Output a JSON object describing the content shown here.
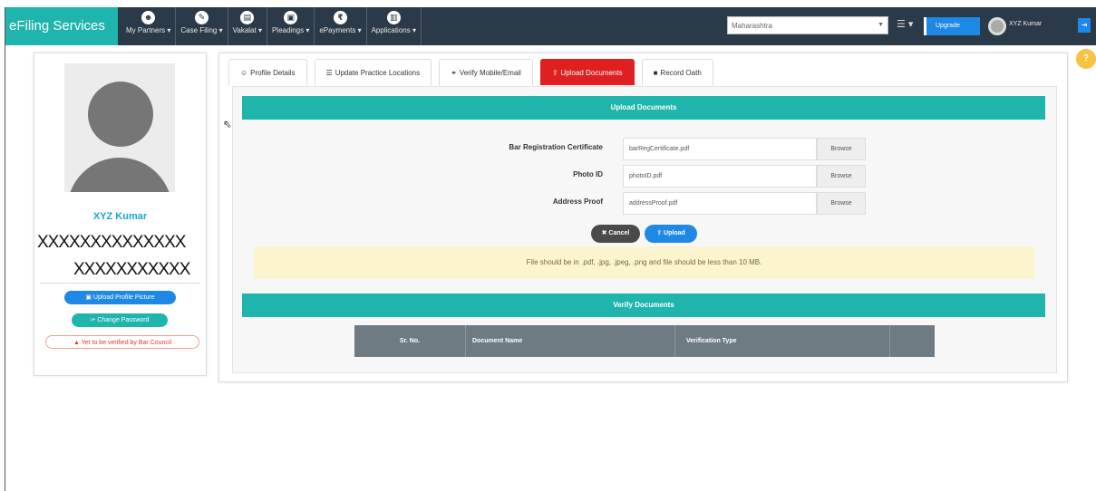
{
  "app": {
    "brand": "eFiling Services"
  },
  "nav": {
    "items": [
      {
        "label": "My Partners ▾",
        "icon": "group-icon"
      },
      {
        "label": "Case Filing ▾",
        "icon": "pencil-icon"
      },
      {
        "label": "Vakalat ▾",
        "icon": "document-icon"
      },
      {
        "label": "Pleadings ▾",
        "icon": "briefcase-icon"
      },
      {
        "label": "ePayments ▾",
        "icon": "rupee-icon"
      },
      {
        "label": "Applications ▾",
        "icon": "file-icon"
      }
    ]
  },
  "header": {
    "state": "Maharashtra",
    "upgrade_label": "Upgrade",
    "user_name": "XYZ Kumar"
  },
  "profile": {
    "name": "XYZ Kumar",
    "masked_line1": "XXXXXXXXXXXXXX",
    "masked_line2": "XXXXXXXXXXX",
    "upload_picture": "Upload Profile Picture",
    "change_password": "Change Password",
    "warning": "Yet to be verified by Bar Council"
  },
  "tabs": [
    {
      "label": "Profile Details",
      "icon": "user-icon",
      "active": false
    },
    {
      "label": "Update Practice Locations",
      "icon": "list-icon",
      "active": false
    },
    {
      "label": "Verify Mobile/Email",
      "icon": "link-icon",
      "active": false
    },
    {
      "label": "Upload Documents",
      "icon": "upload-icon",
      "active": true
    },
    {
      "label": "Record Oath",
      "icon": "video-icon",
      "active": false
    }
  ],
  "upload_section": {
    "title": "Upload Documents",
    "fields": [
      {
        "label": "Bar Registration Certificate",
        "value": "barRegCertificate.pdf",
        "browse": "Browse"
      },
      {
        "label": "Photo ID",
        "value": "photoID.pdf",
        "browse": "Browse"
      },
      {
        "label": "Address Proof",
        "value": "addressProof.pdf",
        "browse": "Browse"
      }
    ],
    "cancel_label": "Cancel",
    "upload_label": "Upload",
    "notice": "File should be in .pdf, .jpg, .jpeg, .png and file should be less than 10 MB."
  },
  "verify_section": {
    "title": "Verify Documents",
    "columns": [
      "Sr. No.",
      "Document Name",
      "Verification Type",
      ""
    ]
  },
  "colors": {
    "topbar": "#2b3a48",
    "brand": "#1fb5ad",
    "active_tab": "#e02020",
    "accent_blue": "#1e88e5",
    "notice_bg": "#fcf3cf"
  }
}
